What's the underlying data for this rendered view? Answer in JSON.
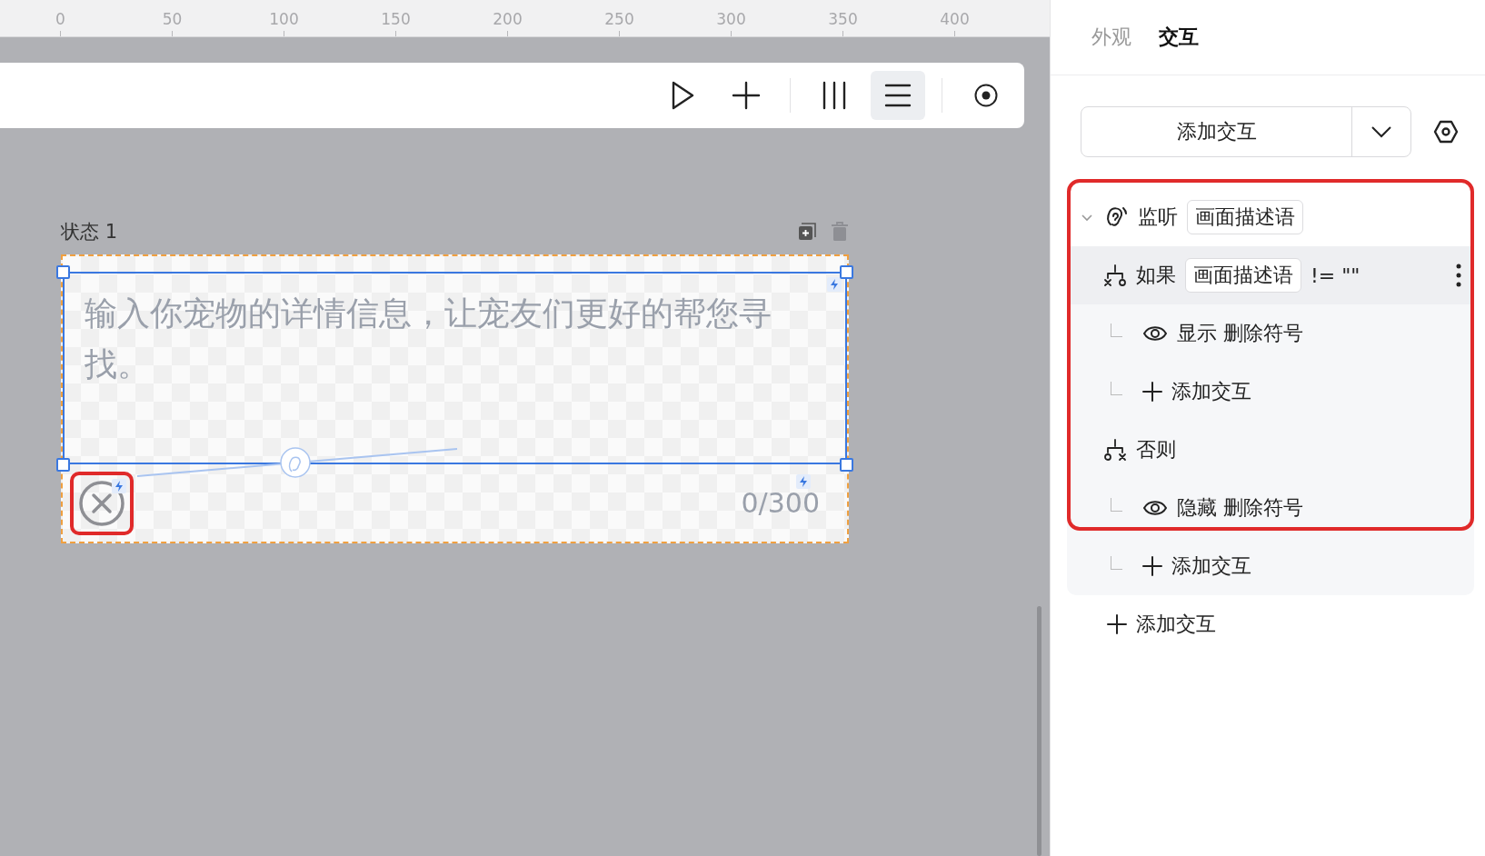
{
  "ruler": {
    "ticks": [
      "0",
      "50",
      "100",
      "150",
      "200",
      "250",
      "300",
      "350",
      "400"
    ]
  },
  "toolbar": {
    "groups": [
      [
        {
          "kind": "play",
          "selected": false
        },
        {
          "kind": "plus",
          "selected": false
        }
      ],
      [
        {
          "kind": "columns",
          "selected": false
        },
        {
          "kind": "rows",
          "selected": true
        }
      ],
      [
        {
          "kind": "target",
          "selected": false
        }
      ]
    ]
  },
  "canvas": {
    "state_label": "状态 1",
    "textarea": {
      "placeholder": "输入你宠物的详情信息，让宠友们更好的帮您寻找。"
    },
    "counter": "0/300"
  },
  "panel": {
    "tabs": [
      {
        "label": "外观",
        "selected": false
      },
      {
        "label": "交互",
        "selected": true
      }
    ],
    "add_button": "添加交互",
    "interactions": [
      {
        "kind": "listener",
        "label": "监听",
        "target": "画面描述语",
        "expanded": true,
        "hovered": false,
        "children": [
          {
            "kind": "if",
            "label": "如果",
            "target": "画面描述语",
            "condition": "!= \"\"",
            "hovered": true,
            "children": [
              {
                "kind": "show",
                "label": "显示 删除符号",
                "hovered": false
              },
              {
                "kind": "add",
                "label": "添加交互",
                "hovered": false
              }
            ]
          },
          {
            "kind": "else",
            "label": "否则",
            "hovered": false,
            "children": [
              {
                "kind": "hide",
                "label": "隐藏 删除符号",
                "hovered": false
              },
              {
                "kind": "add",
                "label": "添加交互",
                "hovered": false
              }
            ]
          }
        ]
      },
      {
        "kind": "add",
        "label": "添加交互",
        "hovered": false
      }
    ]
  }
}
